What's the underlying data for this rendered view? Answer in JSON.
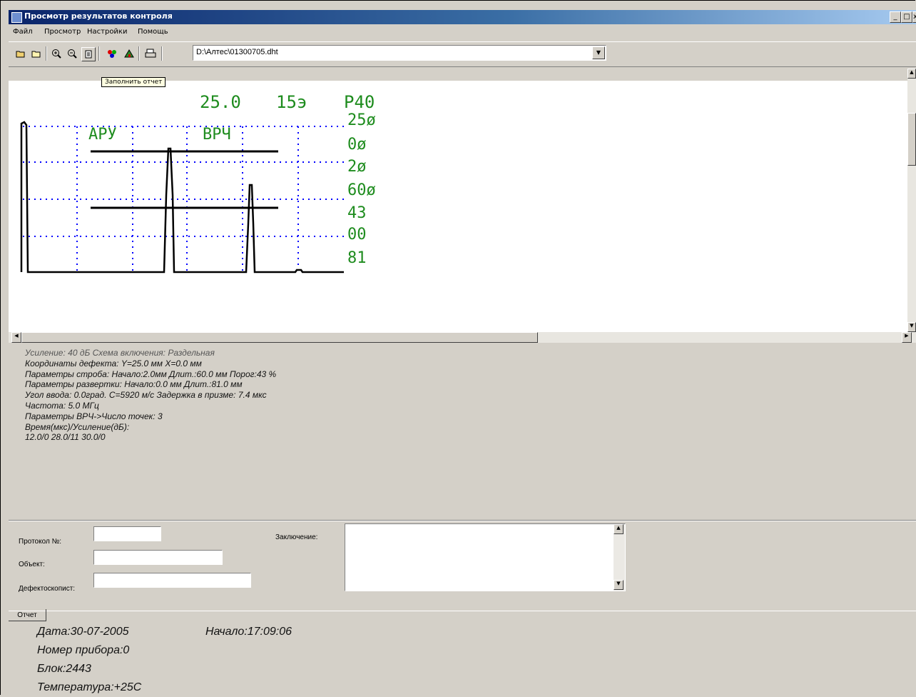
{
  "window": {
    "title": "Просмотр результатов контроля"
  },
  "title_buttons": {
    "minimize": "_",
    "maximize": "□",
    "close": "x"
  },
  "menu": [
    "Файл",
    "Просмотр",
    "Настройки",
    "Помощь"
  ],
  "toolbar": {
    "file_path": "D:\\Алтес\\01300705.dht",
    "tooltip": "Заполнить отчет",
    "icons": [
      "open-folder-icon",
      "folder-icon",
      "zoom-in-icon",
      "zoom-out-icon",
      "report-icon",
      "color-icon",
      "settings-icon",
      "print-icon"
    ]
  },
  "scan": {
    "header": [
      "25.0",
      "15э",
      "P40"
    ],
    "labels": {
      "aru": "АРУ",
      "vrch": "ВРЧ"
    },
    "side_values": [
      "25ø",
      "0ø",
      "2ø",
      "60ø",
      "43",
      "00",
      "81"
    ],
    "colors": {
      "text": "#1e8c1e",
      "grid": "#0000ff",
      "signal": "#000000"
    }
  },
  "params": {
    "gain": "Усиление: 40 дБ    Схема включения: Раздельная",
    "defect": "Координаты дефекта:  Y=25.0 мм  X=0.0 мм",
    "strobe": "Параметры строба: Начало:2.0мм  Длит.:60.0 мм  Порог:43 %",
    "sweep": "Параметры развертки:  Начало:0.0 мм  Длит.:81.0 мм",
    "angle": "Угол ввода: 0.0град.  С=5920 м/с Задержка в призме: 7.4 мкс",
    "freq": "Частота: 5.0 МГц",
    "vrch": "Параметры ВРЧ->Число точек: 3",
    "time_gain": "Время(мкс)/Усиление(дБ):",
    "points": "12.0/0 28.0/11 30.0/0"
  },
  "form": {
    "protocol_label": "Протокол №:",
    "object_label": "Объект:",
    "inspector_label": "Дефектоскопист:",
    "conclusion_label": "Заключение:",
    "protocol_value": "",
    "object_value": "",
    "inspector_value": "",
    "conclusion_value": ""
  },
  "tabs": {
    "report": "Отчет"
  },
  "report": {
    "date": "Дата:30-07-2005",
    "start": "Начало:17:09:06",
    "device": "Номер прибора:0",
    "block": "Блок:2443",
    "temperature": "Температура:+25С"
  }
}
